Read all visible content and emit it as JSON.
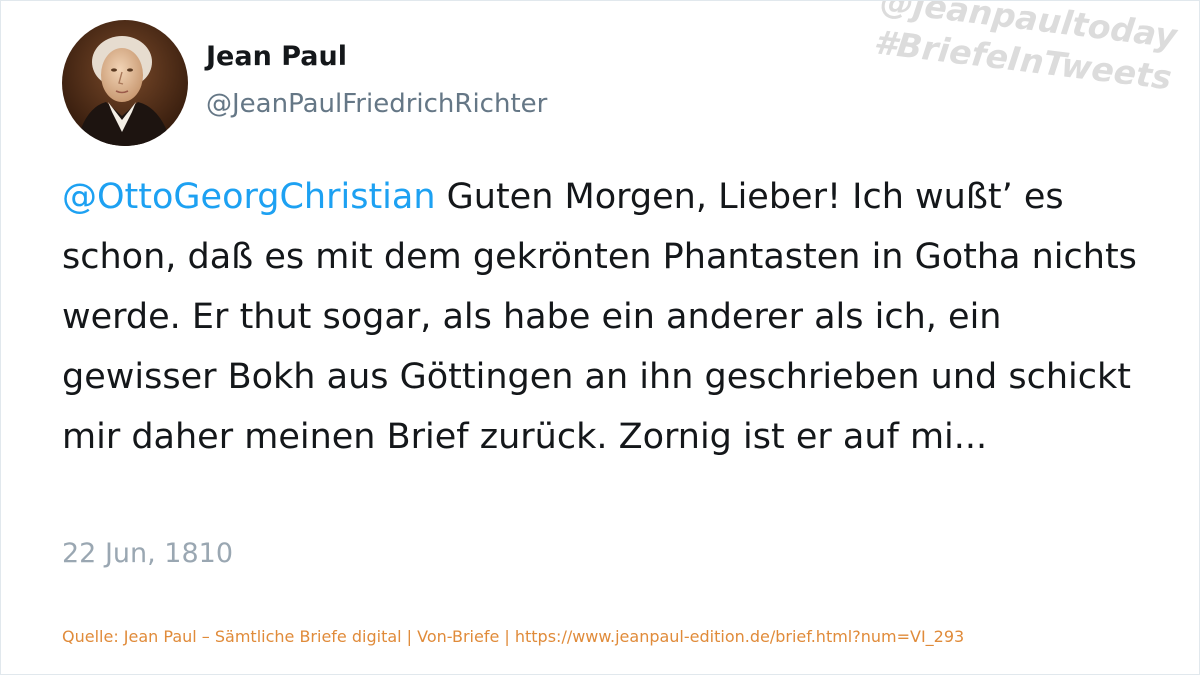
{
  "author": {
    "display_name": "Jean Paul",
    "handle": "@JeanPaulFriedrichRichter",
    "avatar_icon": "portrait-avatar"
  },
  "watermark": {
    "line1": "@jeanpaultoday",
    "line2": "#BriefeInTweets"
  },
  "tweet": {
    "mention": "@OttoGeorgChristian",
    "text": " Guten Morgen, Lieber! Ich wußt’ es schon, daß es mit dem gekrönten Phantasten in Gotha nichts werde. Er thut sogar, als habe ein anderer als ich, ein gewisser Bokh aus Göttingen an ihn geschrieben und schickt mir daher meinen Brief zurück. Zornig ist er auf mi...",
    "date": "22 Jun, 1810"
  },
  "source": "Quelle: Jean Paul – Sämtliche Briefe digital | Von-Briefe | https://www.jeanpaul-edition.de/brief.html?num=VI_293",
  "colors": {
    "mention": "#1da1f2",
    "text": "#14171a",
    "handle": "#657786",
    "date": "#9aa7b2",
    "source": "#e08b3a",
    "watermark": "#dcdcdc"
  }
}
